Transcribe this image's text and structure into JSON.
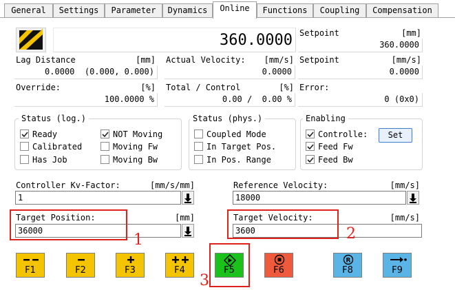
{
  "tabs": [
    "General",
    "Settings",
    "Parameter",
    "Dynamics",
    "Online",
    "Functions",
    "Coupling",
    "Compensation"
  ],
  "position": {
    "value": "360.0000"
  },
  "setpoint_pos": {
    "label": "Setpoint",
    "unit": "[mm]",
    "value": "360.0000"
  },
  "lag_distance": {
    "label": "Lag Distance",
    "unit": "[mm]",
    "value": "0.0000  (0.000, 0.000)"
  },
  "actual_velocity": {
    "label": "Actual Velocity:",
    "unit": "[mm/s]",
    "value": "0.0000"
  },
  "setpoint_vel": {
    "label": "Setpoint",
    "unit": "[mm/s]",
    "value": "0.0000"
  },
  "override": {
    "label": "Override:",
    "unit": "[%]",
    "value": "100.0000 %"
  },
  "total_control": {
    "label": "Total / Control",
    "unit": "[%]",
    "value": "0.00 /  0.00 %"
  },
  "error": {
    "label": "Error:",
    "value": "0 (0x0)"
  },
  "status_log": {
    "title": "Status (log.)",
    "items": [
      {
        "label": "Ready",
        "checked": true
      },
      {
        "label": "Calibrated",
        "checked": false
      },
      {
        "label": "Has Job",
        "checked": false
      },
      {
        "label": "NOT Moving",
        "checked": true
      },
      {
        "label": "Moving Fw",
        "checked": false
      },
      {
        "label": "Moving Bw",
        "checked": false
      }
    ]
  },
  "status_phys": {
    "title": "Status (phys.)",
    "items": [
      {
        "label": "Coupled Mode",
        "checked": false
      },
      {
        "label": "In Target Pos.",
        "checked": false
      },
      {
        "label": "In Pos. Range",
        "checked": false
      }
    ]
  },
  "enabling": {
    "title": "Enabling",
    "items": [
      {
        "label": "Controlle:",
        "checked": true
      },
      {
        "label": "Feed Fw",
        "checked": true
      },
      {
        "label": "Feed Bw",
        "checked": true
      }
    ],
    "set_label": "Set"
  },
  "kv_factor": {
    "label": "Controller Kv-Factor:",
    "unit": "[mm/s/mm]",
    "value": "1"
  },
  "ref_velocity": {
    "label": "Reference Velocity:",
    "unit": "[mm/s]",
    "value": "18000"
  },
  "target_position": {
    "label": "Target Position:",
    "unit": "[mm]",
    "value": "36000"
  },
  "target_velocity": {
    "label": "Target Velocity:",
    "unit": "[mm/s]",
    "value": "3600"
  },
  "annotations": [
    "1",
    "2",
    "3"
  ],
  "fkeys": [
    {
      "label": "F1",
      "icon": "fast-backward-icon",
      "color": "#f5c400"
    },
    {
      "label": "F2",
      "icon": "backward-icon",
      "color": "#f5c400"
    },
    {
      "label": "F3",
      "icon": "forward-icon",
      "color": "#f5c400"
    },
    {
      "label": "F4",
      "icon": "fast-forward-icon",
      "color": "#f5c400"
    },
    {
      "label": "F5",
      "icon": "start-icon",
      "color": "#1cc21c"
    },
    {
      "label": "F6",
      "icon": "stop-icon",
      "color": "#f05a3c"
    },
    {
      "label": "F8",
      "icon": "reset-icon",
      "color": "#5ab4e6"
    },
    {
      "label": "F9",
      "icon": "goto-position-icon",
      "color": "#5ab4e6"
    }
  ]
}
